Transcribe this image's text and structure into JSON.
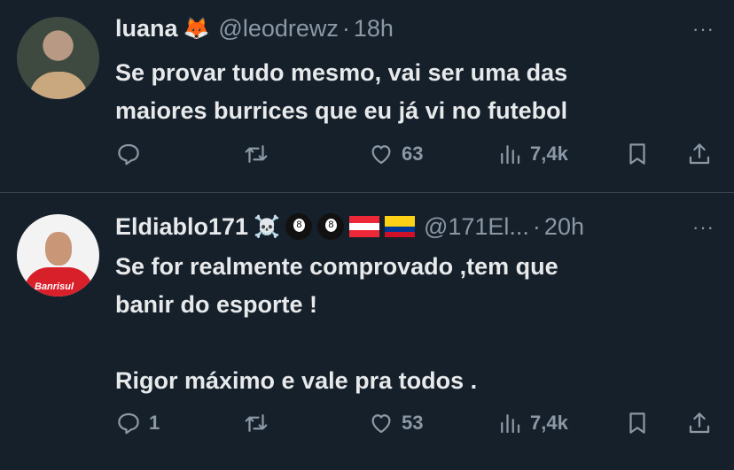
{
  "tweets": [
    {
      "name": "luana",
      "name_emoji": "🦊",
      "handle": "@leodrewz",
      "separator": "·",
      "time": "18h",
      "more": "···",
      "text_lines": [
        "Se provar tudo mesmo, vai ser uma das",
        "maiores burrices que eu já vi no futebol"
      ],
      "replies": "",
      "retweets": "",
      "likes": "63",
      "views": "7,4k"
    },
    {
      "name": "Eldiablo171",
      "name_emoji": "☠️",
      "handle": "@171El...",
      "separator": "·",
      "time": "20h",
      "more": "···",
      "text_lines": [
        "Se for realmente comprovado ,tem que",
        "banir do esporte !",
        "",
        "Rigor máximo e vale pra todos ."
      ],
      "replies": "1",
      "retweets": "",
      "likes": "53",
      "views": "7,4k"
    }
  ],
  "avatar2_logo": "Banrisul",
  "colors": {
    "background": "#15202b",
    "text": "#e7e9ea",
    "secondary": "#8b98a5",
    "divider": "#38444d"
  },
  "icons": [
    "reply-icon",
    "retweet-icon",
    "like-icon",
    "views-icon",
    "bookmark-icon",
    "share-icon",
    "more-icon"
  ]
}
